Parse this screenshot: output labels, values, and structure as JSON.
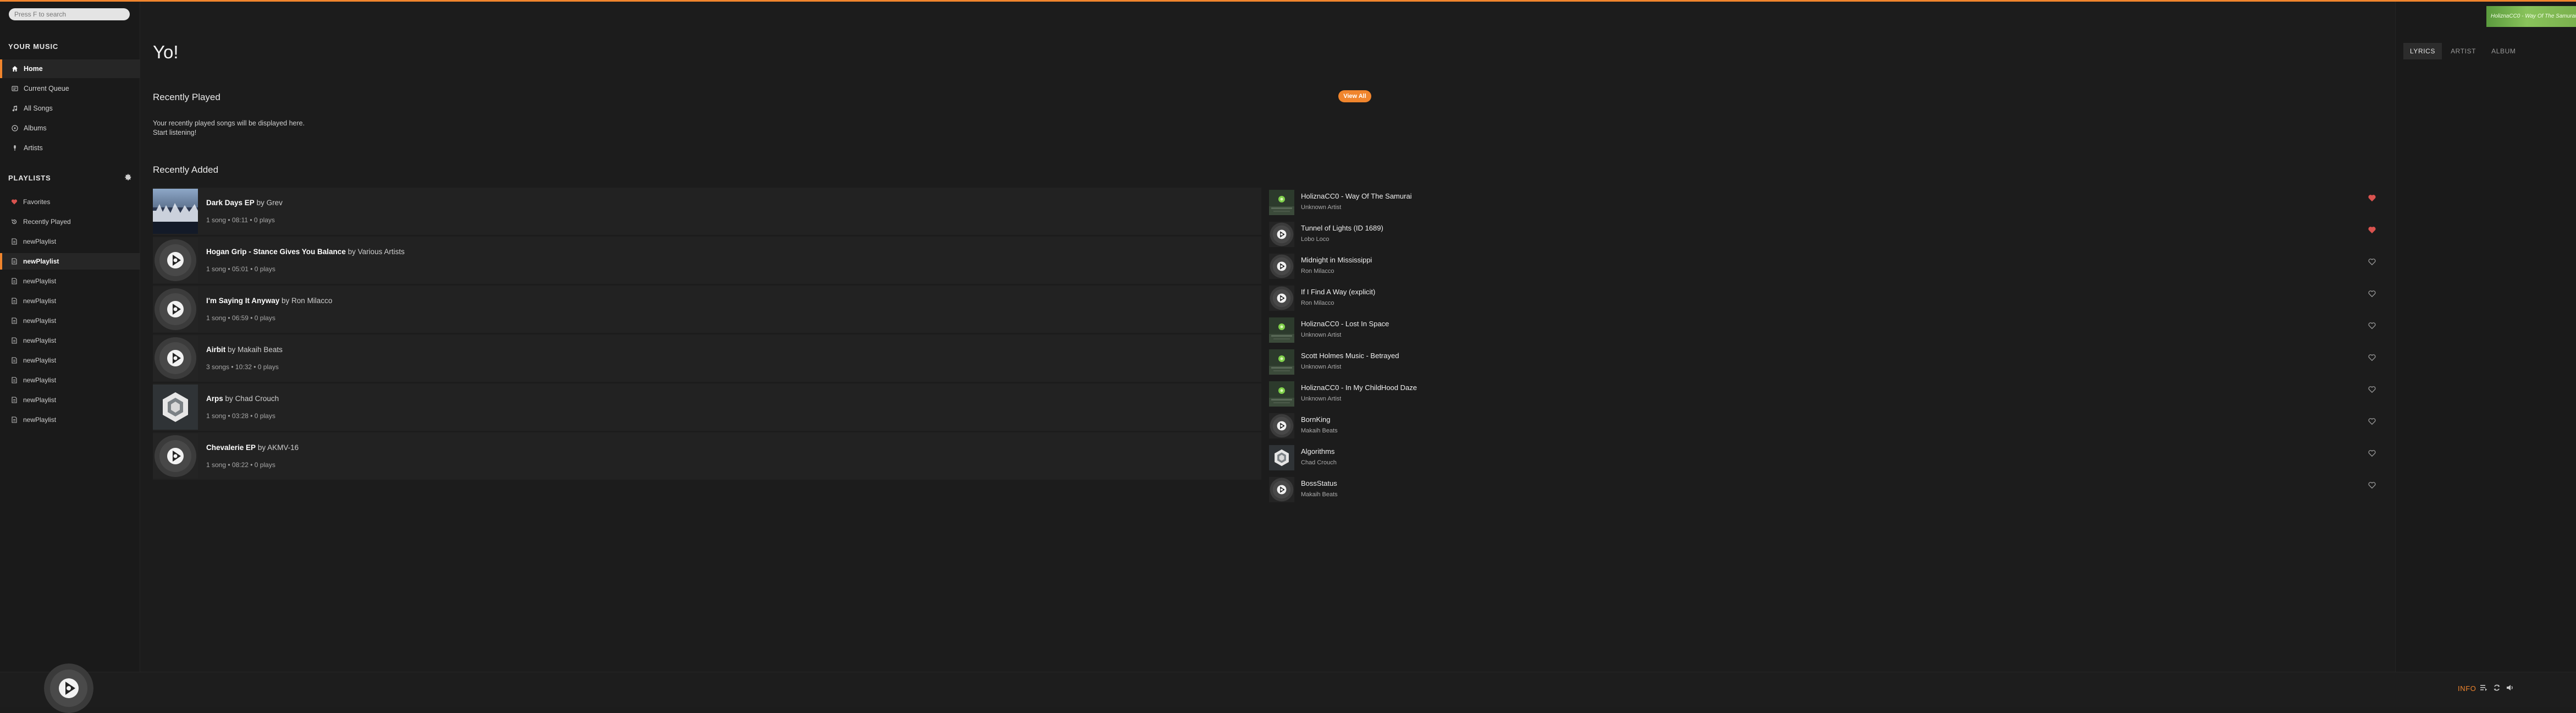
{
  "search": {
    "placeholder": "Press F to search"
  },
  "sidebar": {
    "your_music_heading": "YOUR MUSIC",
    "items": [
      {
        "label": "Home",
        "icon": "home-icon",
        "active": true
      },
      {
        "label": "Current Queue",
        "icon": "queue-icon",
        "active": false
      },
      {
        "label": "All Songs",
        "icon": "music-note-icon",
        "active": false
      },
      {
        "label": "Albums",
        "icon": "album-icon",
        "active": false
      },
      {
        "label": "Artists",
        "icon": "microphone-icon",
        "active": false
      }
    ],
    "playlists_heading": "PLAYLISTS",
    "add_playlist_icon": "gear-icon",
    "playlists": [
      {
        "label": "Favorites",
        "icon": "heart-icon",
        "active": false
      },
      {
        "label": "Recently Played",
        "icon": "history-icon",
        "active": false
      },
      {
        "label": "newPlaylist",
        "icon": "playlist-icon",
        "active": false
      },
      {
        "label": "newPlaylist",
        "icon": "playlist-icon",
        "active": true
      },
      {
        "label": "newPlaylist",
        "icon": "playlist-icon",
        "active": false
      },
      {
        "label": "newPlaylist",
        "icon": "playlist-icon",
        "active": false
      },
      {
        "label": "newPlaylist",
        "icon": "playlist-icon",
        "active": false
      },
      {
        "label": "newPlaylist",
        "icon": "playlist-icon",
        "active": false
      },
      {
        "label": "newPlaylist",
        "icon": "playlist-icon",
        "active": false
      },
      {
        "label": "newPlaylist",
        "icon": "playlist-icon",
        "active": false
      },
      {
        "label": "newPlaylist",
        "icon": "playlist-icon",
        "active": false
      },
      {
        "label": "newPlaylist",
        "icon": "playlist-icon",
        "active": false
      }
    ]
  },
  "main": {
    "greeting": "Yo!",
    "recently_played": {
      "title": "Recently Played",
      "view_all_label": "View All",
      "empty_line1": "Your recently played songs will be displayed here.",
      "empty_line2": "Start listening!"
    },
    "recently_added": {
      "title": "Recently Added",
      "by_word": "by",
      "albums": [
        {
          "title": "Dark Days EP",
          "artist": "Grev",
          "meta": "1 song • 08:11 • 0 plays",
          "art": "dark-photo"
        },
        {
          "title": "Hogan Grip - Stance Gives You Balance",
          "artist": "Various Artists",
          "meta": "1 song • 05:01 • 0 plays",
          "art": "disc"
        },
        {
          "title": "I'm Saying It Anyway",
          "artist": "Ron Milacco",
          "meta": "1 song • 06:59 • 0 plays",
          "art": "disc"
        },
        {
          "title": "Airbit",
          "artist": "Makaih Beats",
          "meta": "3 songs • 10:32 • 0 plays",
          "art": "disc"
        },
        {
          "title": "Arps",
          "artist": "Chad Crouch",
          "meta": "1 song • 03:28 • 0 plays",
          "art": "hexagon"
        },
        {
          "title": "Chevalerie EP",
          "artist": "AKMV-16",
          "meta": "1 song • 08:22 • 0 plays",
          "art": "disc"
        }
      ],
      "songs": [
        {
          "title": "HoliznaCC0 - Way Of The Samurai",
          "artist": "Unknown Artist",
          "liked": true,
          "art": "green-thumb"
        },
        {
          "title": "Tunnel of Lights (ID 1689)",
          "artist": "Lobo Loco",
          "liked": true,
          "art": "disc"
        },
        {
          "title": "Midnight in Mississippi",
          "artist": "Ron Milacco",
          "liked": false,
          "art": "disc"
        },
        {
          "title": "If I Find A Way (explicit)",
          "artist": "Ron Milacco",
          "liked": false,
          "art": "disc"
        },
        {
          "title": "HoliznaCC0 - Lost In Space",
          "artist": "Unknown Artist",
          "liked": false,
          "art": "green-thumb"
        },
        {
          "title": "Scott Holmes Music - Betrayed",
          "artist": "Unknown Artist",
          "liked": false,
          "art": "green-thumb"
        },
        {
          "title": "HoliznaCC0 - In My ChildHood Daze",
          "artist": "Unknown Artist",
          "liked": false,
          "art": "green-thumb"
        },
        {
          "title": "BornKing",
          "artist": "Makaih Beats",
          "liked": false,
          "art": "disc"
        },
        {
          "title": "Algorithms",
          "artist": "Chad Crouch",
          "liked": false,
          "art": "hexagon"
        },
        {
          "title": "BossStatus",
          "artist": "Makaih Beats",
          "liked": false,
          "art": "disc"
        }
      ]
    }
  },
  "right_panel": {
    "tabs": [
      {
        "label": "LYRICS",
        "active": true
      },
      {
        "label": "ARTIST",
        "active": false
      },
      {
        "label": "ALBUM",
        "active": false
      }
    ],
    "thumbnail_text": "HoliznaCC0 - Way Of The Samurai"
  },
  "bottom_bar": {
    "info_label": "INFO",
    "controls": [
      "queue-icon",
      "repeat-icon",
      "volume-icon"
    ]
  },
  "colors": {
    "accent": "#f0852d",
    "liked": "#d9534f",
    "background": "#1c1c1c"
  }
}
